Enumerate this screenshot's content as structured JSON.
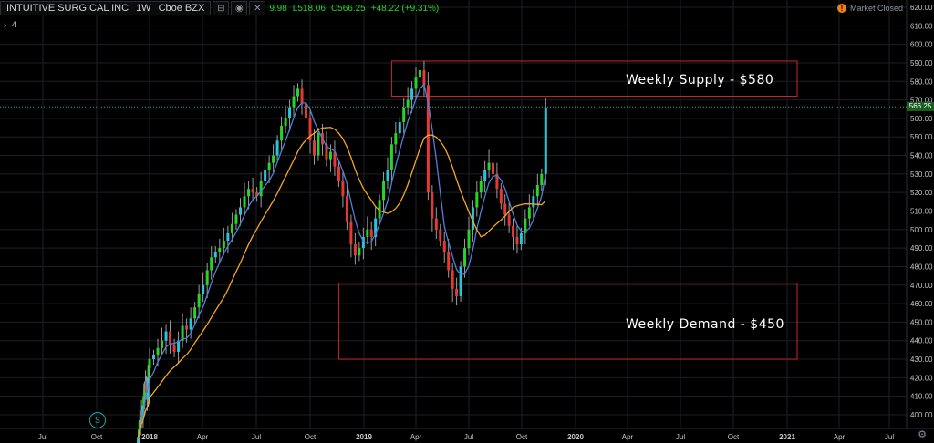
{
  "header": {
    "symbol": "INTUITIVE SURGICAL INC",
    "interval": "1W",
    "exchange": "Cboe BZX",
    "ohlc_visible": [
      "9.98",
      "L518.06",
      "C566.25",
      "+48.22 (+9.31%)"
    ],
    "indicator_count": "4",
    "market_status": "Market Closed",
    "market_status_icon": "alert-icon"
  },
  "price_tag": "566.25",
  "zones": [
    {
      "label": "Weekly Supply - $580",
      "y_top": 591,
      "y_bottom": 572,
      "x_start": "2019-02-18",
      "color": "#c62828"
    },
    {
      "label": "Weekly Demand - $450",
      "y_top": 471,
      "y_bottom": 430,
      "x_start": "2018-11-19",
      "color": "#c62828"
    }
  ],
  "chart_data": {
    "type": "candlestick",
    "title": "",
    "xlabel": "",
    "ylabel": "",
    "y_range": [
      395,
      620
    ],
    "y_ticks": [
      400,
      410,
      420,
      430,
      440,
      450,
      460,
      470,
      480,
      490,
      500,
      510,
      520,
      530,
      540,
      550,
      560,
      570,
      580,
      590,
      600,
      610,
      620
    ],
    "x_ticks": [
      {
        "label": "Jul",
        "date": "2016-07-01"
      },
      {
        "label": "Oct",
        "date": "2016-10-01"
      },
      {
        "label": "2018",
        "date": "2018-01-01",
        "bold": true
      },
      {
        "label": "Apr",
        "date": "2018-04-01"
      },
      {
        "label": "Jul",
        "date": "2018-07-01"
      },
      {
        "label": "Oct",
        "date": "2018-10-01"
      },
      {
        "label": "2019",
        "date": "2019-01-01",
        "bold": true
      },
      {
        "label": "Apr",
        "date": "2019-04-01"
      },
      {
        "label": "Jul",
        "date": "2019-07-01"
      },
      {
        "label": "Oct",
        "date": "2019-10-01"
      },
      {
        "label": "2020",
        "date": "2020-01-01",
        "bold": true
      },
      {
        "label": "Apr",
        "date": "2020-04-01"
      },
      {
        "label": "Jul",
        "date": "2020-07-01"
      },
      {
        "label": "Oct",
        "date": "2020-10-01"
      },
      {
        "label": "2021",
        "date": "2021-01-01",
        "bold": true
      },
      {
        "label": "Apr",
        "date": "2021-04-01"
      },
      {
        "label": "Jul",
        "date": "2021-07-01"
      }
    ],
    "bull_color": "#26d526",
    "bull_alt_color": "#26c6da",
    "bear_color": "#e53935",
    "ma_fast_color": "#4f7fd6",
    "ma_slow_color": "#f5a623",
    "current_price_line": 566.25,
    "closes": [
      388,
      392,
      396,
      398,
      402,
      399,
      405,
      410,
      414,
      418,
      412,
      408,
      420,
      425,
      430,
      432,
      436,
      440,
      445,
      438,
      434,
      440,
      448,
      446,
      452,
      458,
      465,
      470,
      478,
      485,
      488,
      490,
      494,
      498,
      503,
      508,
      512,
      518,
      522,
      520,
      518,
      526,
      532,
      536,
      540,
      548,
      556,
      560,
      566,
      572,
      576,
      568,
      560,
      548,
      540,
      552,
      546,
      538,
      542,
      534,
      526,
      518,
      504,
      492,
      486,
      490,
      496,
      500,
      496,
      506,
      516,
      526,
      532,
      546,
      552,
      558,
      566,
      570,
      576,
      582,
      586,
      578,
      520,
      506,
      500,
      494,
      488,
      478,
      468,
      464,
      480,
      490,
      500,
      512,
      520,
      526,
      532,
      536,
      530,
      522,
      514,
      508,
      502,
      496,
      492,
      498,
      506,
      512,
      518,
      524,
      530,
      566
    ],
    "fast_ma": [],
    "slow_ma": []
  }
}
